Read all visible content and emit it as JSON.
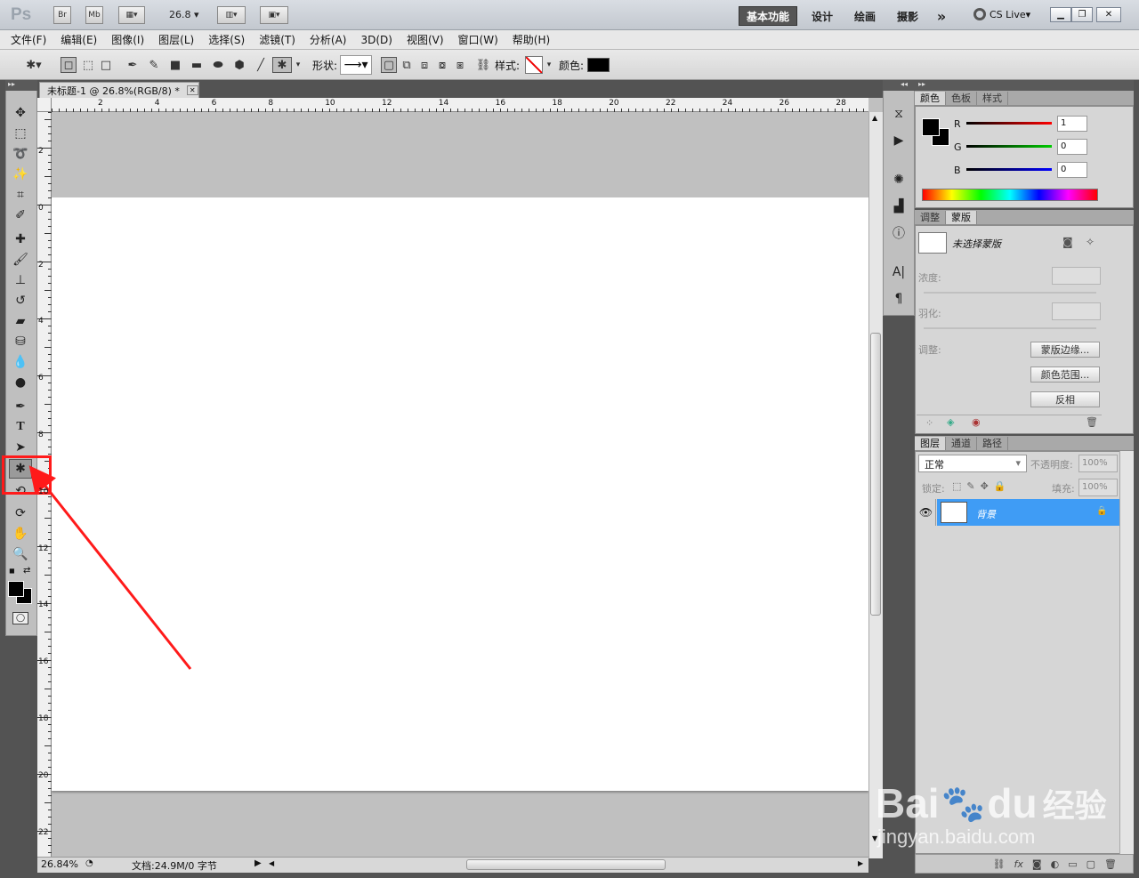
{
  "titlebar": {
    "app_logo": "Ps",
    "bridge_btn": "Br",
    "minibridge_btn": "Mb",
    "zoom_value": "26.8",
    "workspaces": [
      "基本功能",
      "设计",
      "绘画",
      "摄影"
    ],
    "more": "»",
    "cs_live": "CS Live"
  },
  "menu": [
    "文件(F)",
    "编辑(E)",
    "图像(I)",
    "图层(L)",
    "选择(S)",
    "滤镜(T)",
    "分析(A)",
    "3D(D)",
    "视图(V)",
    "窗口(W)",
    "帮助(H)"
  ],
  "options": {
    "shape_label": "形状:",
    "style_label": "样式:",
    "color_label": "颜色:",
    "color_value": "#000000"
  },
  "document": {
    "tab_title": "未标题-1 @ 26.8%(RGB/8) *",
    "ruler_top": [
      "2",
      "4",
      "6",
      "8",
      "10",
      "12",
      "14",
      "16",
      "18",
      "20",
      "22",
      "24",
      "26",
      "28"
    ],
    "ruler_left": [
      "2",
      "0",
      "2",
      "4",
      "6",
      "8",
      "10",
      "12",
      "14",
      "16",
      "18",
      "20",
      "22"
    ],
    "status_zoom": "26.84%",
    "status_doc": "文档:24.9M/0 字节"
  },
  "color_panel": {
    "tabs": [
      "颜色",
      "色板",
      "样式"
    ],
    "r_label": "R",
    "g_label": "G",
    "b_label": "B",
    "r_value": "1",
    "g_value": "0",
    "b_value": "0"
  },
  "mask_panel": {
    "tabs": [
      "调整",
      "蒙版"
    ],
    "no_mask": "未选择蒙版",
    "density_label": "浓度:",
    "feather_label": "羽化:",
    "adjust_label": "调整:",
    "btn_mask_edge": "蒙版边缘...",
    "btn_color_range": "颜色范围...",
    "btn_invert": "反相"
  },
  "layers_panel": {
    "tabs": [
      "图层",
      "通道",
      "路径"
    ],
    "blend_mode": "正常",
    "opacity_label": "不透明度:",
    "opacity_value": "100%",
    "lock_label": "锁定:",
    "fill_label": "填充:",
    "fill_value": "100%",
    "layer_name": "背景"
  },
  "watermark": {
    "brand": "Bai",
    "brand2": "du",
    "suffix": "经验",
    "url": "jingyan.baidu.com"
  }
}
